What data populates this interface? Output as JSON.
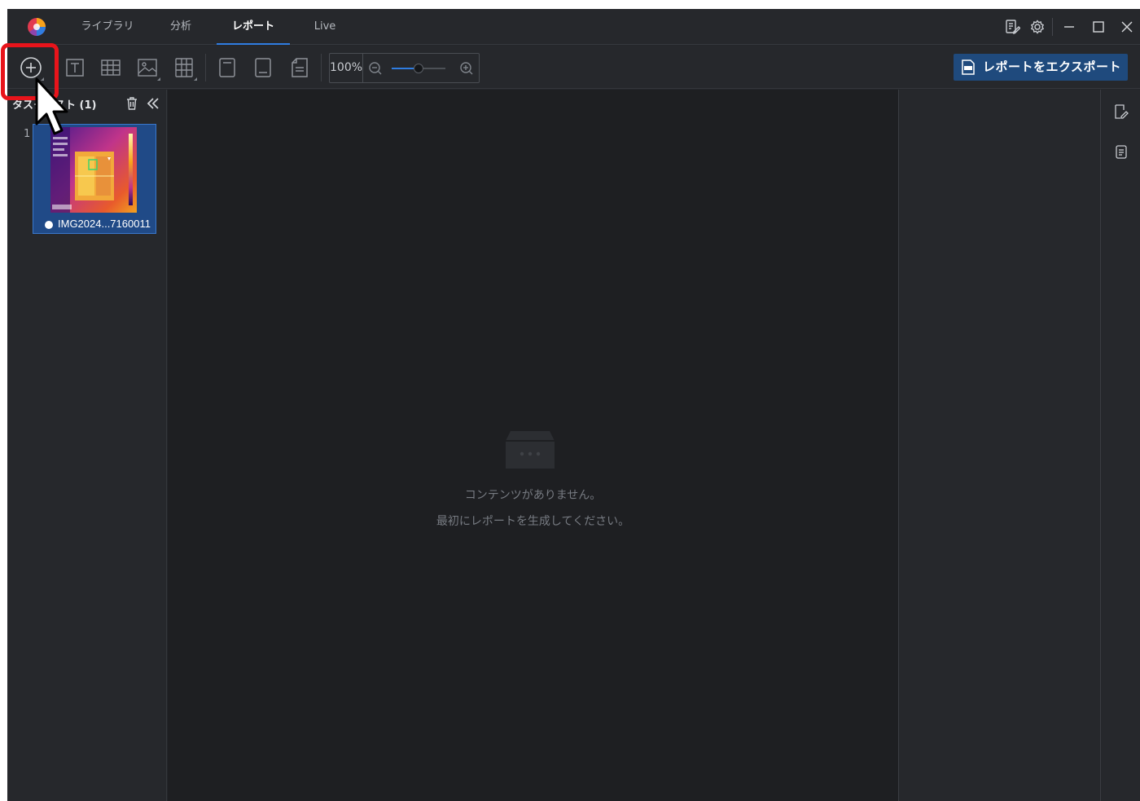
{
  "titlebar": {
    "tabs": [
      {
        "label": "ライブラリ",
        "active": false
      },
      {
        "label": "分析",
        "active": false
      },
      {
        "label": "レポート",
        "active": true
      },
      {
        "label": "Live",
        "active": false
      }
    ],
    "icons": [
      "report-edit-icon",
      "settings-icon",
      "minimize-icon",
      "maximize-icon",
      "close-icon"
    ]
  },
  "toolbar": {
    "tools": [
      "add-icon",
      "text-icon",
      "table-icon",
      "image-icon",
      "layout-grid-icon",
      "page-header-icon",
      "page-footer-icon",
      "page-icon"
    ],
    "zoom": {
      "value": "100%",
      "level": 0.5
    },
    "export_label": "レポートをエクスポート",
    "accent": "#2f7de1",
    "export_bg": "#1f4a7d"
  },
  "left_panel": {
    "title": "タスクリスト (1)",
    "items": [
      {
        "index": "1",
        "name": "IMG2024...7160011",
        "selected": true
      }
    ]
  },
  "canvas": {
    "empty_line1": "コンテンツがありません。",
    "empty_line2": "最初にレポートを生成してください。"
  },
  "annotation": {
    "highlight_color": "#e8141b",
    "target": "add-button"
  }
}
